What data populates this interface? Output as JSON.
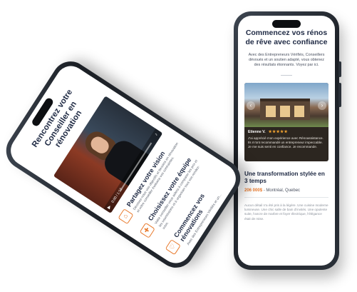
{
  "colors": {
    "accent": "#e8782a",
    "heading": "#1f2a44",
    "star": "#f3a431",
    "phone_frame": "#1b1f25"
  },
  "left_phone": {
    "title": "Rencontrez votre Conseiller en rénovation",
    "video": {
      "play_icon": "play-icon",
      "time": "0:00 / 1:12",
      "volume_icon": "volume-icon"
    },
    "steps": [
      {
        "icon": "house-document-icon",
        "heading": "Partagez votre vision",
        "text": "Décrivez-nous vos objectifs et besoins en rénovation et votre conseiller évaluera vos contraintes."
      },
      {
        "icon": "puzzle-icon",
        "heading": "Choisissez votre équipe",
        "text": "Votre conseiller vous aidera à comparer les prix et les soumissions et à organiser tous vos rendez-vous."
      },
      {
        "icon": "heart-house-icon",
        "heading": "Commencez vos rénovations",
        "text": "Avec des Entrepreneurs Vérifiés et un..."
      }
    ]
  },
  "right_phone": {
    "title": "Commencez vos rénos de rêve avec confiance",
    "description": "Avec des Entrepreneurs Vérifiés, Conseillers dévoués et un soutien adapté, vous obtenez des résultats étonnants. Voyez par ici.",
    "testimonial": {
      "reviewer": "Etienne V.",
      "stars": "★★★★★",
      "quote": "J'ai apprécié mon expérience avec Rénoassistance. Ils m'ont recommandé un entrepreneur impeccable. Je me suis senti en confiance. Je recommande.",
      "prev_icon": "chevron-left-icon",
      "next_icon": "chevron-right-icon"
    },
    "project": {
      "title": "Une transformation stylée en 3 temps",
      "price": "206 000$",
      "location": " - Montréal, Quebec",
      "body": "Aucun détail n'a été pris à la légère. Une cuisine moderne lumineuse. Une chic salle de bain d'invités. Une opulente suite, l'ancre de marbre et foyer électrique, l'élégance était de mise."
    }
  }
}
